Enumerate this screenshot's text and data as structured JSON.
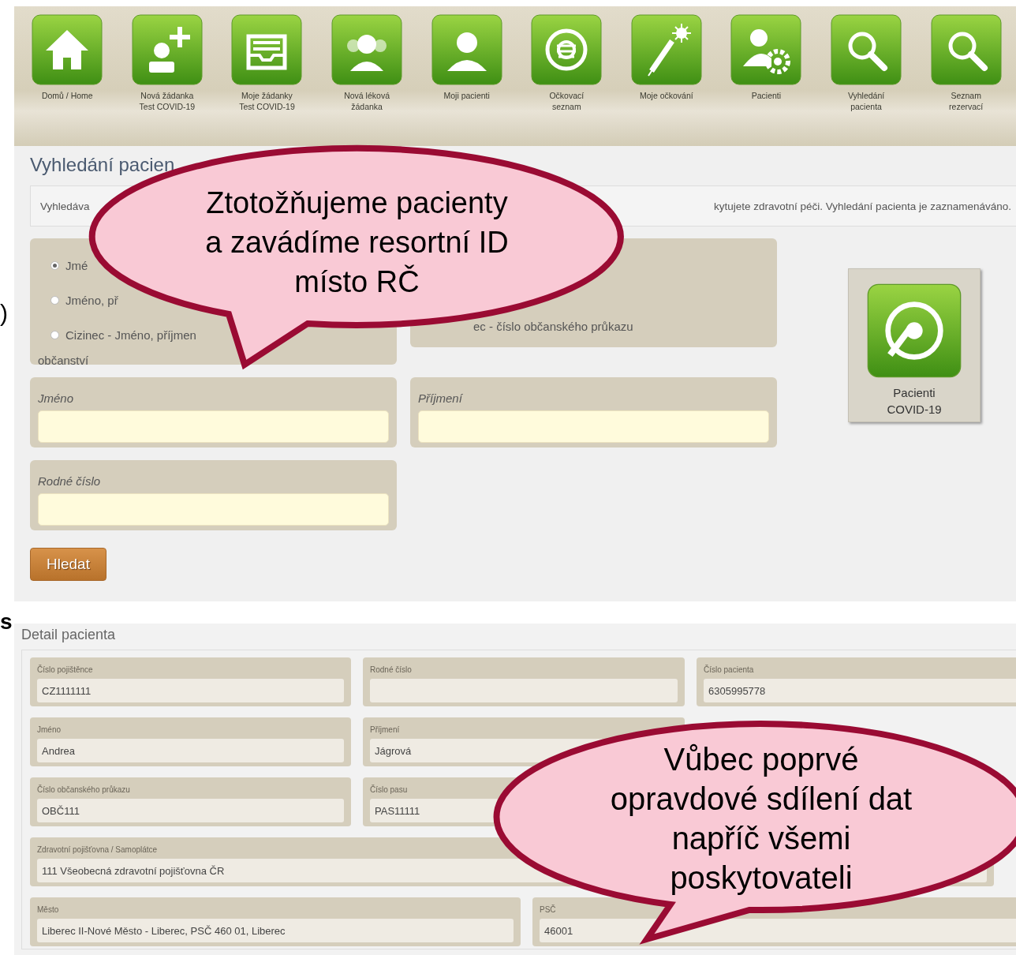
{
  "slide_fragments": [
    {
      "text": ")"
    },
    {
      "text": "s"
    }
  ],
  "nav": [
    {
      "label": "Domů / Home"
    },
    {
      "label": "Nová žádanka\nTest COVID-19"
    },
    {
      "label": "Moje žádanky\nTest COVID-19"
    },
    {
      "label": "Nová léková\nžádanka"
    },
    {
      "label": "Moji pacienti"
    },
    {
      "label": "Očkovací\nseznam"
    },
    {
      "label": "Moje očkování"
    },
    {
      "label": "Pacienti"
    },
    {
      "label": "Vyhledání\npacienta"
    },
    {
      "label": "Seznam\nrezervací"
    }
  ],
  "search": {
    "title": "Vyhledání pacien",
    "info_start": "Vyhledáva",
    "info_end": "kytujete zdravotní péči. Vyhledání pacienta je zaznamenáváno.",
    "options": [
      {
        "label": "Jmé",
        "selected": true
      },
      {
        "label": "Jméno, př",
        "selected": false
      },
      {
        "label": "Cizinec - Jméno, příjmen",
        "selected": false
      }
    ],
    "options_continuation": "občanství",
    "option_right": "ec - číslo občanského průkazu",
    "fields": [
      {
        "label": "Jméno"
      },
      {
        "label": "Příjmení"
      },
      {
        "label": "Rodné číslo"
      }
    ],
    "button": "Hledat",
    "tile": {
      "label": "Pacienti\nCOVID-19"
    }
  },
  "detail": {
    "title": "Detail pacienta",
    "rows": [
      [
        {
          "label": "Číslo pojištěnce",
          "value": "CZ1111111"
        },
        {
          "label": "Rodné číslo"
        },
        {
          "label": "Číslo pacienta",
          "value": "6305995778"
        }
      ],
      [
        {
          "label": "Jméno",
          "value": "Andrea"
        },
        {
          "label": "Příjmení",
          "value": "Jágrová"
        }
      ],
      [
        {
          "label": "Číslo občanského průkazu",
          "value": "OBČ111"
        },
        {
          "label": "Číslo pasu",
          "value": "PAS11111"
        }
      ],
      [
        {
          "label": "Zdravotní pojišťovna / Samoplátce",
          "value": "111 Všeobecná zdravotní pojišťovna ČR"
        }
      ],
      [
        {
          "label": "Město",
          "value": "Liberec II-Nové Město - Liberec, PSČ 460 01, Liberec"
        },
        {
          "label": "PSČ",
          "value": "46001"
        }
      ]
    ]
  },
  "callouts": [
    {
      "text": "Ztotožňujeme pacienty\na zavádíme resortní ID\nmísto RČ"
    },
    {
      "text": "Vůbec poprvé\nopravdové sdílení dat\nnapříč všemi\nposkytovateli"
    }
  ]
}
